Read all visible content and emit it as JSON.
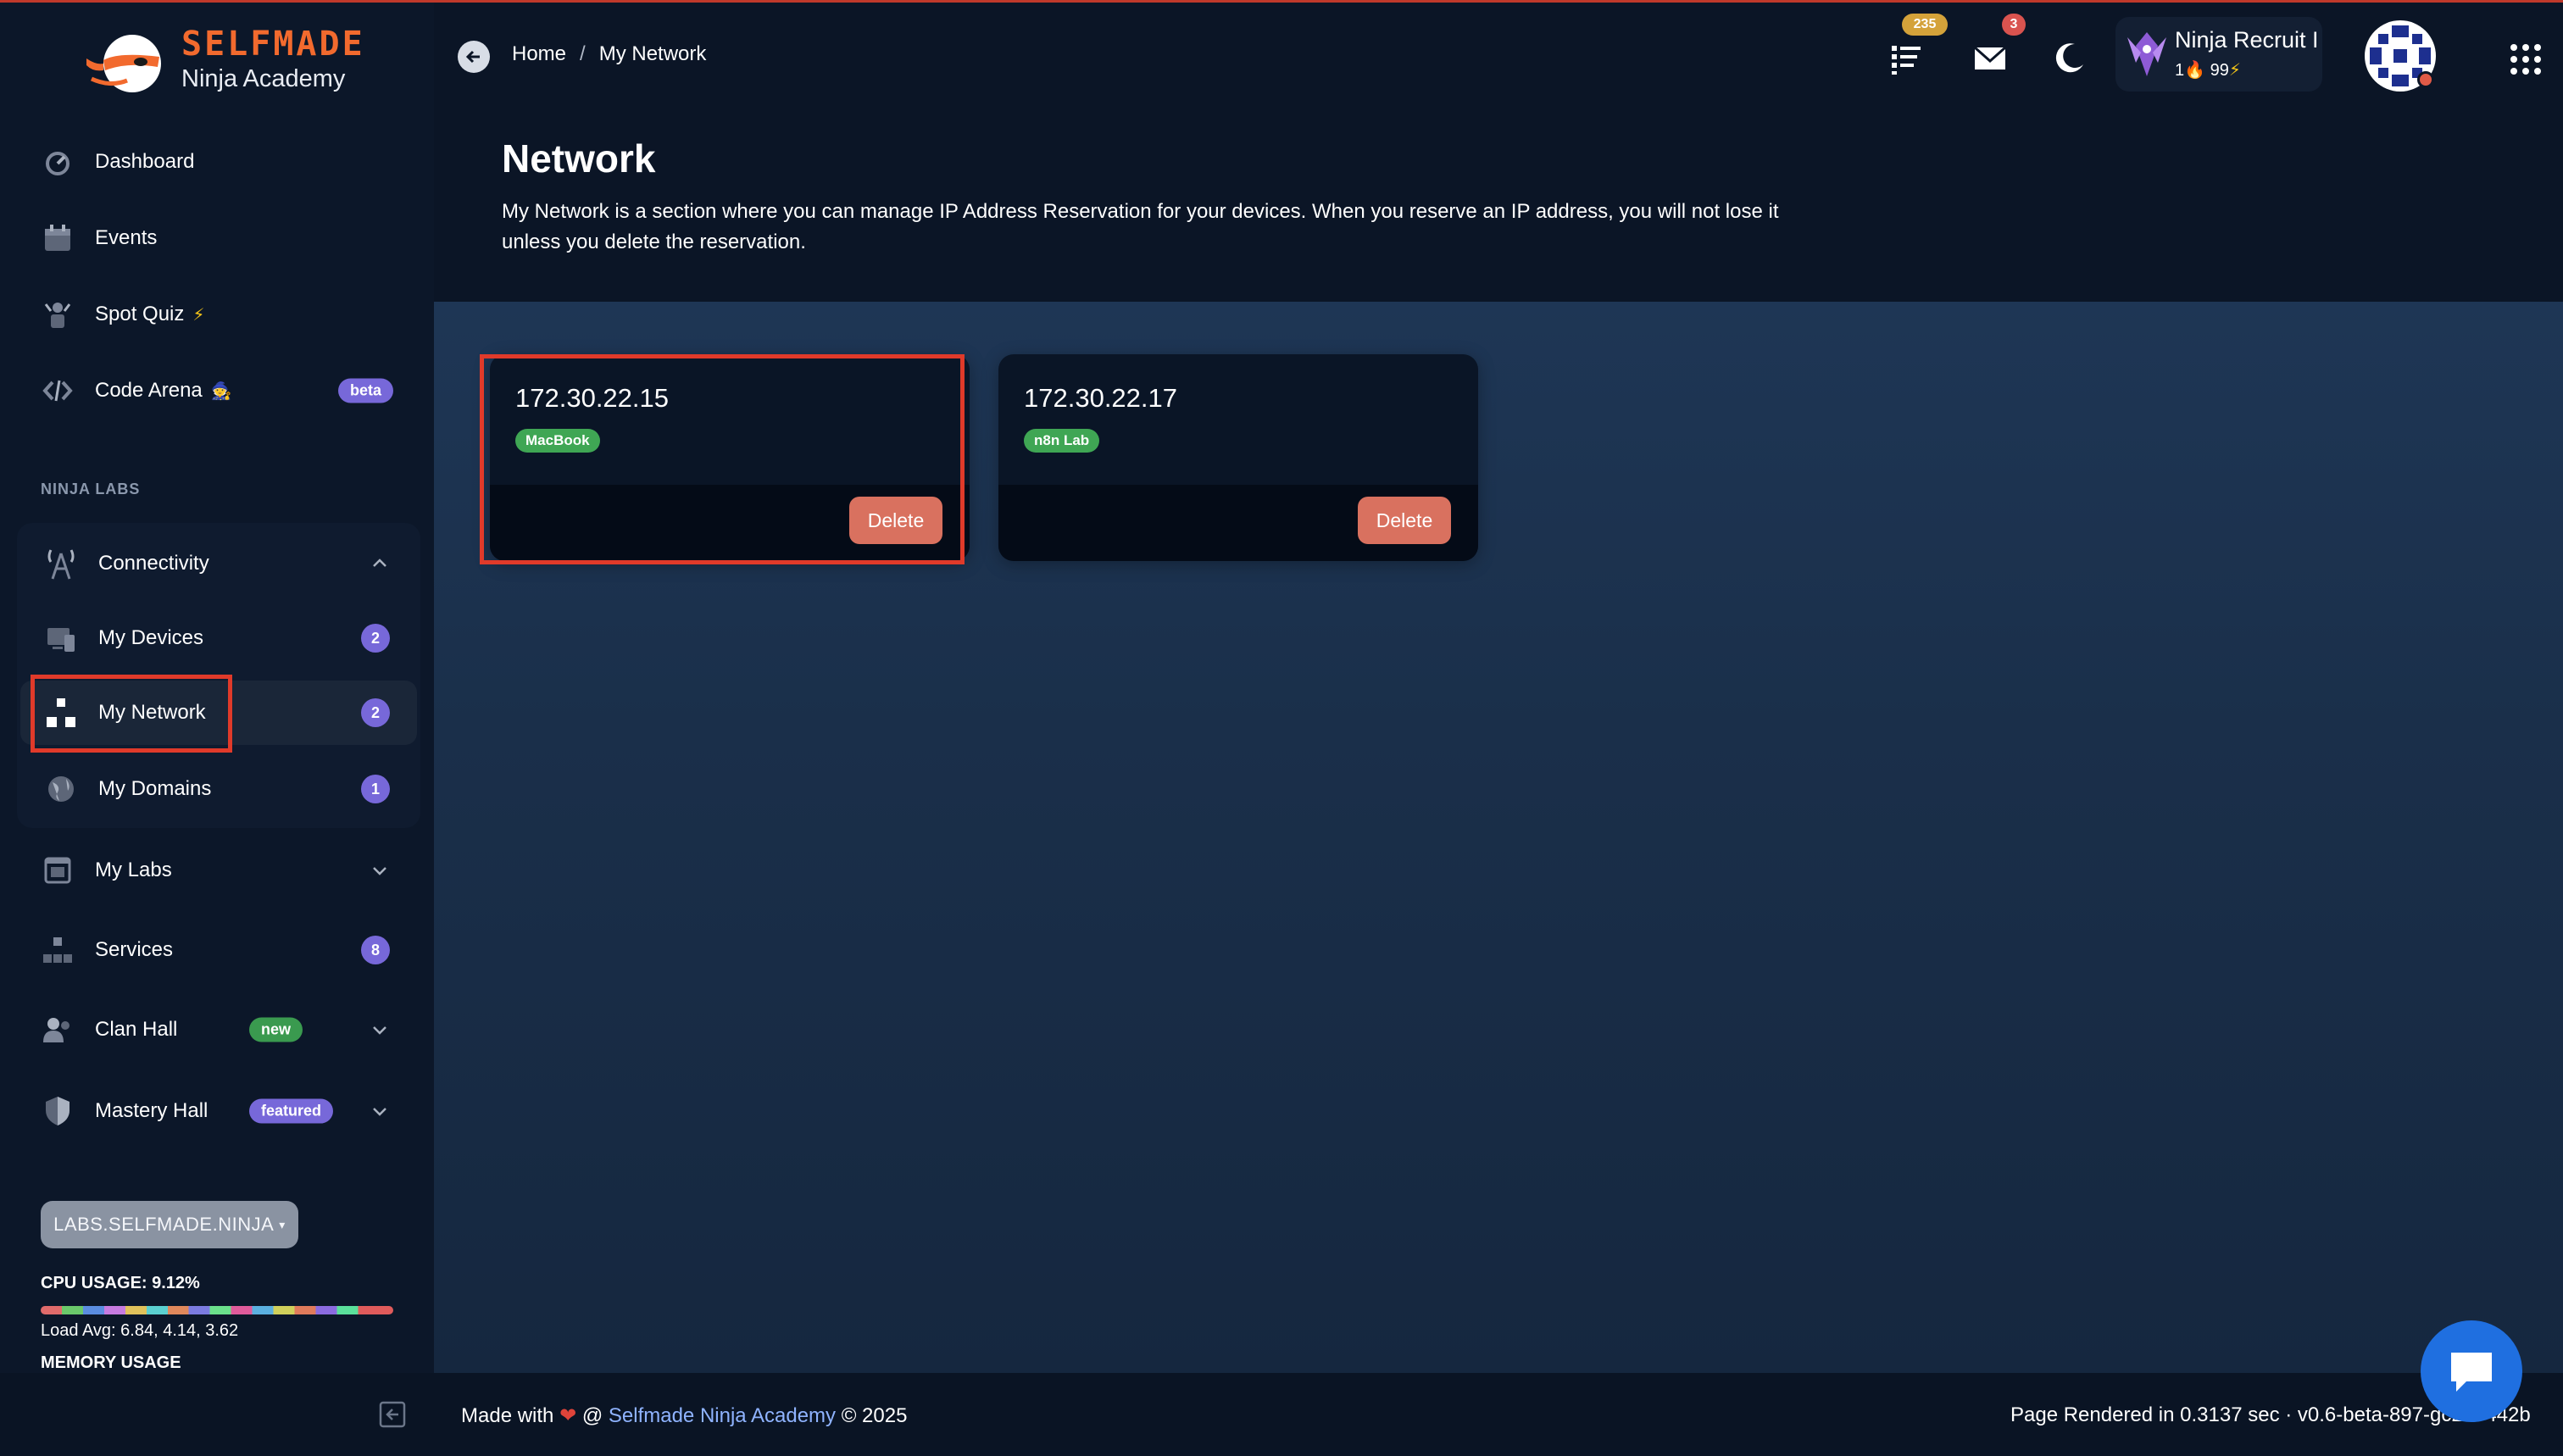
{
  "brand": {
    "title": "SELFMADE",
    "subtitle": "Ninja Academy",
    "accent": "#f26a2e"
  },
  "header": {
    "breadcrumb": [
      "Home",
      "My Network"
    ],
    "breadcrumb_sep": "/",
    "notifications_count": "235",
    "messages_count": "3",
    "profile_name": "Ninja Recruit I",
    "profile_streak": "1",
    "profile_points": "99"
  },
  "sidebar": {
    "items": [
      {
        "label": "Dashboard",
        "icon": "dashboard-icon"
      },
      {
        "label": "Events",
        "icon": "calendar-icon"
      },
      {
        "label": "Spot Quiz",
        "icon": "quiz-icon",
        "emoji": "⚡"
      },
      {
        "label": "Code Arena",
        "icon": "code-icon",
        "emoji": "🧙",
        "pill": "beta"
      }
    ],
    "section_label": "NINJA LABS",
    "connectivity": {
      "label": "Connectivity",
      "children": [
        {
          "label": "My Devices",
          "count": "2"
        },
        {
          "label": "My Network",
          "count": "2"
        },
        {
          "label": "My Domains",
          "count": "1"
        }
      ]
    },
    "more": [
      {
        "label": "My Labs"
      },
      {
        "label": "Services",
        "count": "8"
      },
      {
        "label": "Clan Hall",
        "pill": "new"
      },
      {
        "label": "Mastery Hall",
        "pill": "featured"
      }
    ],
    "domain_button": "LABS.SELFMADE.NINJA",
    "cpu_usage": "CPU USAGE: 9.12%",
    "load_avg": "Load Avg: 6.84, 4.14, 3.62",
    "memory_usage": "MEMORY USAGE"
  },
  "main": {
    "title": "Network",
    "description": "My Network is a section where you can manage IP Address Reservation for your devices. When you reserve an IP address, you will not lose it unless you delete the reservation.",
    "reservations": [
      {
        "ip": "172.30.22.15",
        "tag": "MacBook",
        "action": "Delete"
      },
      {
        "ip": "172.30.22.17",
        "tag": "n8n Lab",
        "action": "Delete"
      }
    ]
  },
  "footer": {
    "made_with": "Made with",
    "at": "@",
    "link": "Selfmade Ninja Academy",
    "year": "© 2025",
    "rendered": "Page Rendered in 0.3137 sec · v0.6-beta-897-gc2... 442b"
  }
}
